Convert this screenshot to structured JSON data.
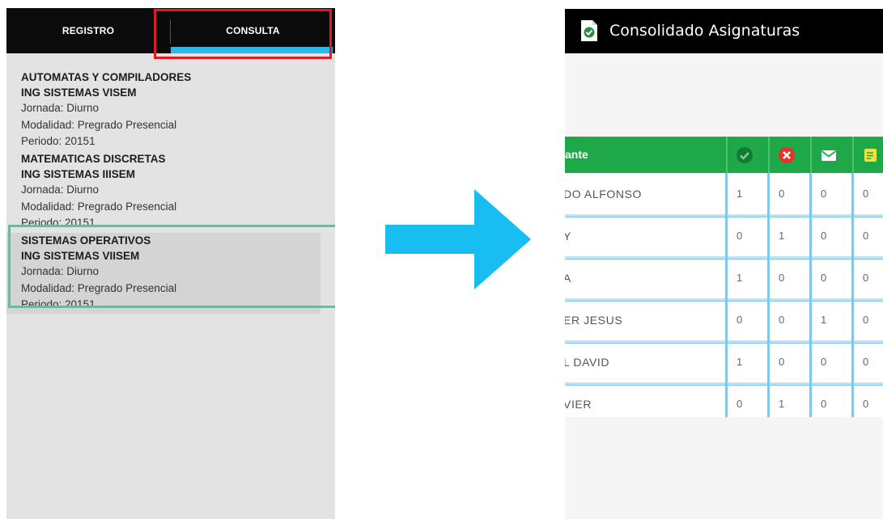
{
  "left_screen": {
    "tabs": [
      {
        "label": "REGISTRO"
      },
      {
        "label": "CONSULTA"
      }
    ],
    "subjects": [
      {
        "title": "AUTOMATAS Y COMPILADORES",
        "program": "ING SISTEMAS VISEM",
        "jornada": "Jornada: Diurno",
        "modalidad": "Modalidad: Pregrado Presencial",
        "periodo": "Periodo: 20151"
      },
      {
        "title": "MATEMATICAS DISCRETAS",
        "program": "ING SISTEMAS IIISEM",
        "jornada": "Jornada: Diurno",
        "modalidad": "Modalidad: Pregrado Presencial",
        "periodo": "Periodo: 20151"
      },
      {
        "title": "SISTEMAS OPERATIVOS",
        "program": "ING SISTEMAS VIISEM",
        "jornada": "Jornada: Diurno",
        "modalidad": "Modalidad: Pregrado Presencial",
        "periodo": "Periodo: 20151"
      }
    ]
  },
  "right_screen": {
    "app_title": "Consolidado Asignaturas",
    "table": {
      "header_name": "ante",
      "header_icons": [
        "check-circle-icon",
        "x-circle-icon",
        "envelope-icon",
        "note-icon"
      ],
      "rows": [
        {
          "name": "DO ALFONSO",
          "values": [
            "1",
            "0",
            "0",
            "0"
          ]
        },
        {
          "name": "Y",
          "values": [
            "0",
            "1",
            "0",
            "0"
          ]
        },
        {
          "name": "A",
          "values": [
            "1",
            "0",
            "0",
            "0"
          ]
        },
        {
          "name": "ER JESUS",
          "values": [
            "0",
            "0",
            "1",
            "0"
          ]
        },
        {
          "name": "L DAVID",
          "values": [
            "1",
            "0",
            "0",
            "0"
          ]
        },
        {
          "name": "VIER",
          "values": [
            "0",
            "1",
            "0",
            "0"
          ]
        }
      ]
    }
  },
  "colors": {
    "tab_indicator": "#2bb8ea",
    "highlight_red": "#e01b24",
    "selection_green": "#71b6a0",
    "arrow": "#18bdf2",
    "table_header": "#1fa84a",
    "grid_blue": "#7fc8ea"
  }
}
